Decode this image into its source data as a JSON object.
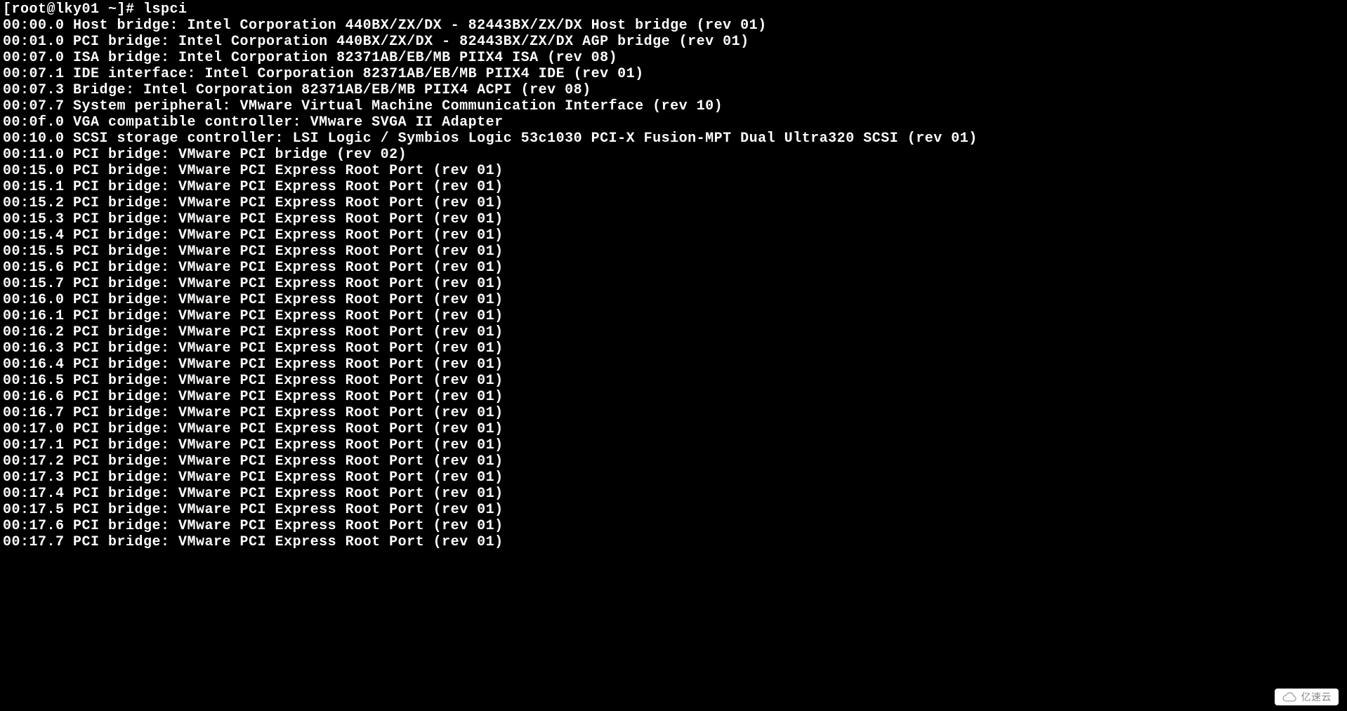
{
  "prompt": "[root@lky01 ~]# lspci",
  "lines": [
    "00:00.0 Host bridge: Intel Corporation 440BX/ZX/DX - 82443BX/ZX/DX Host bridge (rev 01)",
    "00:01.0 PCI bridge: Intel Corporation 440BX/ZX/DX - 82443BX/ZX/DX AGP bridge (rev 01)",
    "00:07.0 ISA bridge: Intel Corporation 82371AB/EB/MB PIIX4 ISA (rev 08)",
    "00:07.1 IDE interface: Intel Corporation 82371AB/EB/MB PIIX4 IDE (rev 01)",
    "00:07.3 Bridge: Intel Corporation 82371AB/EB/MB PIIX4 ACPI (rev 08)",
    "00:07.7 System peripheral: VMware Virtual Machine Communication Interface (rev 10)",
    "00:0f.0 VGA compatible controller: VMware SVGA II Adapter",
    "00:10.0 SCSI storage controller: LSI Logic / Symbios Logic 53c1030 PCI-X Fusion-MPT Dual Ultra320 SCSI (rev 01)",
    "00:11.0 PCI bridge: VMware PCI bridge (rev 02)",
    "00:15.0 PCI bridge: VMware PCI Express Root Port (rev 01)",
    "00:15.1 PCI bridge: VMware PCI Express Root Port (rev 01)",
    "00:15.2 PCI bridge: VMware PCI Express Root Port (rev 01)",
    "00:15.3 PCI bridge: VMware PCI Express Root Port (rev 01)",
    "00:15.4 PCI bridge: VMware PCI Express Root Port (rev 01)",
    "00:15.5 PCI bridge: VMware PCI Express Root Port (rev 01)",
    "00:15.6 PCI bridge: VMware PCI Express Root Port (rev 01)",
    "00:15.7 PCI bridge: VMware PCI Express Root Port (rev 01)",
    "00:16.0 PCI bridge: VMware PCI Express Root Port (rev 01)",
    "00:16.1 PCI bridge: VMware PCI Express Root Port (rev 01)",
    "00:16.2 PCI bridge: VMware PCI Express Root Port (rev 01)",
    "00:16.3 PCI bridge: VMware PCI Express Root Port (rev 01)",
    "00:16.4 PCI bridge: VMware PCI Express Root Port (rev 01)",
    "00:16.5 PCI bridge: VMware PCI Express Root Port (rev 01)",
    "00:16.6 PCI bridge: VMware PCI Express Root Port (rev 01)",
    "00:16.7 PCI bridge: VMware PCI Express Root Port (rev 01)",
    "00:17.0 PCI bridge: VMware PCI Express Root Port (rev 01)",
    "00:17.1 PCI bridge: VMware PCI Express Root Port (rev 01)",
    "00:17.2 PCI bridge: VMware PCI Express Root Port (rev 01)",
    "00:17.3 PCI bridge: VMware PCI Express Root Port (rev 01)",
    "00:17.4 PCI bridge: VMware PCI Express Root Port (rev 01)",
    "00:17.5 PCI bridge: VMware PCI Express Root Port (rev 01)",
    "00:17.6 PCI bridge: VMware PCI Express Root Port (rev 01)",
    "00:17.7 PCI bridge: VMware PCI Express Root Port (rev 01)"
  ],
  "watermark": {
    "text": "亿速云"
  }
}
